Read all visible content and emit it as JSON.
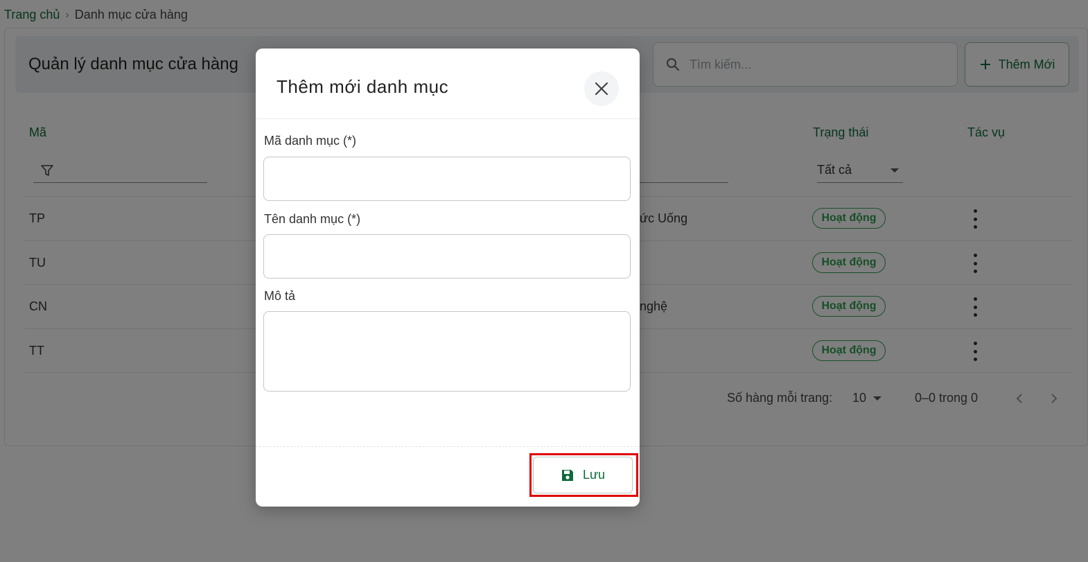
{
  "breadcrumb": {
    "home": "Trang chủ",
    "current": "Danh mục cửa hàng"
  },
  "page": {
    "title": "Quản lý danh mục cửa hàng",
    "search_placeholder": "Tìm kiếm...",
    "add_label": "Thêm Mới"
  },
  "table": {
    "columns": {
      "code": "Mã",
      "status": "Trạng thái",
      "actions": "Tác vụ"
    },
    "status_filter": "Tất cả",
    "rows": [
      {
        "code": "TP",
        "name_fragment": "ức Uống",
        "status": "Hoạt động"
      },
      {
        "code": "TU",
        "name_fragment": "",
        "status": "Hoạt động"
      },
      {
        "code": "CN",
        "name_fragment": "nghệ",
        "status": "Hoạt động"
      },
      {
        "code": "TT",
        "name_fragment": "",
        "status": "Hoạt động"
      }
    ]
  },
  "pagination": {
    "rows_per_page_label": "Số hàng mỗi trang:",
    "rows_per_page": "10",
    "range": "0–0 trong 0"
  },
  "modal": {
    "title": "Thêm mới danh mục",
    "fields": {
      "code_label": "Mã danh mục (*)",
      "name_label": "Tên danh mục (*)",
      "description_label": "Mô tả"
    },
    "save_label": "Lưu"
  },
  "colors": {
    "brand_green": "#0e6b3a",
    "status_green": "#2e9e4e",
    "highlight_red": "#e00000"
  }
}
